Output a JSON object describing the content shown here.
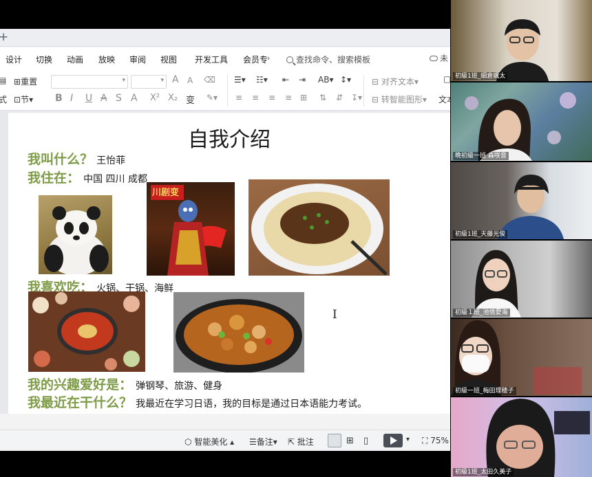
{
  "menu": {
    "tabs": [
      "设计",
      "切换",
      "动画",
      "放映",
      "审阅",
      "视图",
      "开发工具",
      "会员专"
    ],
    "more": "›",
    "search_placeholder": "查找命令、搜索模板",
    "cloud_label": "未"
  },
  "ribbon": {
    "reset_label": "重置",
    "section_label": "节",
    "format_label": "式",
    "align_text_label": "对齐文本",
    "smartart_label": "转智能图形",
    "textbox_label": "文本",
    "bold": "B",
    "italic": "I",
    "underline": "U",
    "strike": "A",
    "shadow": "S",
    "color": "A",
    "superscript": "X²",
    "subscript": "X₂",
    "phonetic": "变",
    "grow_font": "A",
    "shrink_font": "A"
  },
  "slide": {
    "title": "自我介绍",
    "q1": "我叫什么？",
    "a1": "王怡菲",
    "q2": "我住在：",
    "a2": "中国 四川 成都",
    "q3": "我喜欢吃：",
    "a3": "火锅、干锅、海鲜",
    "q4": "我的兴趣爱好是：",
    "a4": "弹钢琴、旅游、健身",
    "q5": "我最近在干什么？",
    "a5": "我最近在学习日语，我的目标是通过日本语能力考试。",
    "opera_banner": "川剧变",
    "text_cursor": "I"
  },
  "statusbar": {
    "beautify": "智能美化",
    "notes": "备注",
    "comments": "批注",
    "zoom": "75%"
  },
  "participants": [
    {
      "name": "初級1班_細倉颯太"
    },
    {
      "name": "晩初級一班 森咲音"
    },
    {
      "name": "初級1班_天藤光俊"
    },
    {
      "name": "初級１班_池情愛海"
    },
    {
      "name": "初級一班_梅田理穂子"
    },
    {
      "name": "初級1班_太田久美子"
    }
  ]
}
